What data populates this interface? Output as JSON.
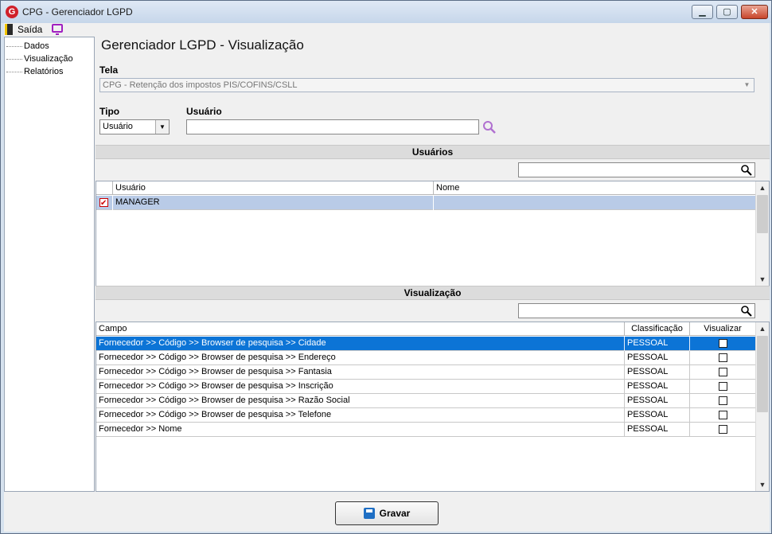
{
  "window": {
    "title": "CPG - Gerenciador LGPD",
    "logo_letter": "G",
    "min_glyph": "▁",
    "max_glyph": "▢",
    "close_glyph": "✕"
  },
  "menu": {
    "exit_label": "Saída",
    "exit_icon": "door-exit-icon",
    "screen_icon": "monitor-icon"
  },
  "tree": {
    "items": [
      {
        "label": "Dados"
      },
      {
        "label": "Visualização"
      },
      {
        "label": "Relatórios"
      }
    ]
  },
  "page": {
    "title": "Gerenciador LGPD - Visualização",
    "tela_label": "Tela",
    "tela_value": "CPG - Retenção dos impostos PIS/COFINS/CSLL",
    "tipo_label": "Tipo",
    "tipo_value": "Usuário",
    "usuario_label": "Usuário",
    "usuario_value": ""
  },
  "usuarios": {
    "section_title": "Usuários",
    "filter_value": "",
    "columns": [
      "Usuário",
      "Nome"
    ],
    "rows": [
      {
        "checked": true,
        "usuario": "MANAGER",
        "nome": ""
      }
    ]
  },
  "visualizacao": {
    "section_title": "Visualização",
    "filter_value": "",
    "columns": [
      "Campo",
      "Classificação",
      "Visualizar"
    ],
    "rows": [
      {
        "campo": "Fornecedor >> Código >> Browser de pesquisa >> Cidade",
        "classificacao": "PESSOAL",
        "visualizar": false
      },
      {
        "campo": "Fornecedor >> Código >> Browser de pesquisa >> Endereço",
        "classificacao": "PESSOAL",
        "visualizar": false
      },
      {
        "campo": "Fornecedor >> Código >> Browser de pesquisa >> Fantasia",
        "classificacao": "PESSOAL",
        "visualizar": false
      },
      {
        "campo": "Fornecedor >> Código >> Browser de pesquisa >> Inscrição",
        "classificacao": "PESSOAL",
        "visualizar": false
      },
      {
        "campo": "Fornecedor >> Código >> Browser de pesquisa >> Razão Social",
        "classificacao": "PESSOAL",
        "visualizar": false
      },
      {
        "campo": "Fornecedor >> Código >> Browser de pesquisa >> Telefone",
        "classificacao": "PESSOAL",
        "visualizar": false
      },
      {
        "campo": "Fornecedor >> Nome",
        "classificacao": "PESSOAL",
        "visualizar": false
      }
    ]
  },
  "footer": {
    "save_label": "Gravar"
  },
  "colors": {
    "selection": "#0c74d6",
    "selected_user_row": "#b9cbe7",
    "search_accent": "#b070d0"
  }
}
